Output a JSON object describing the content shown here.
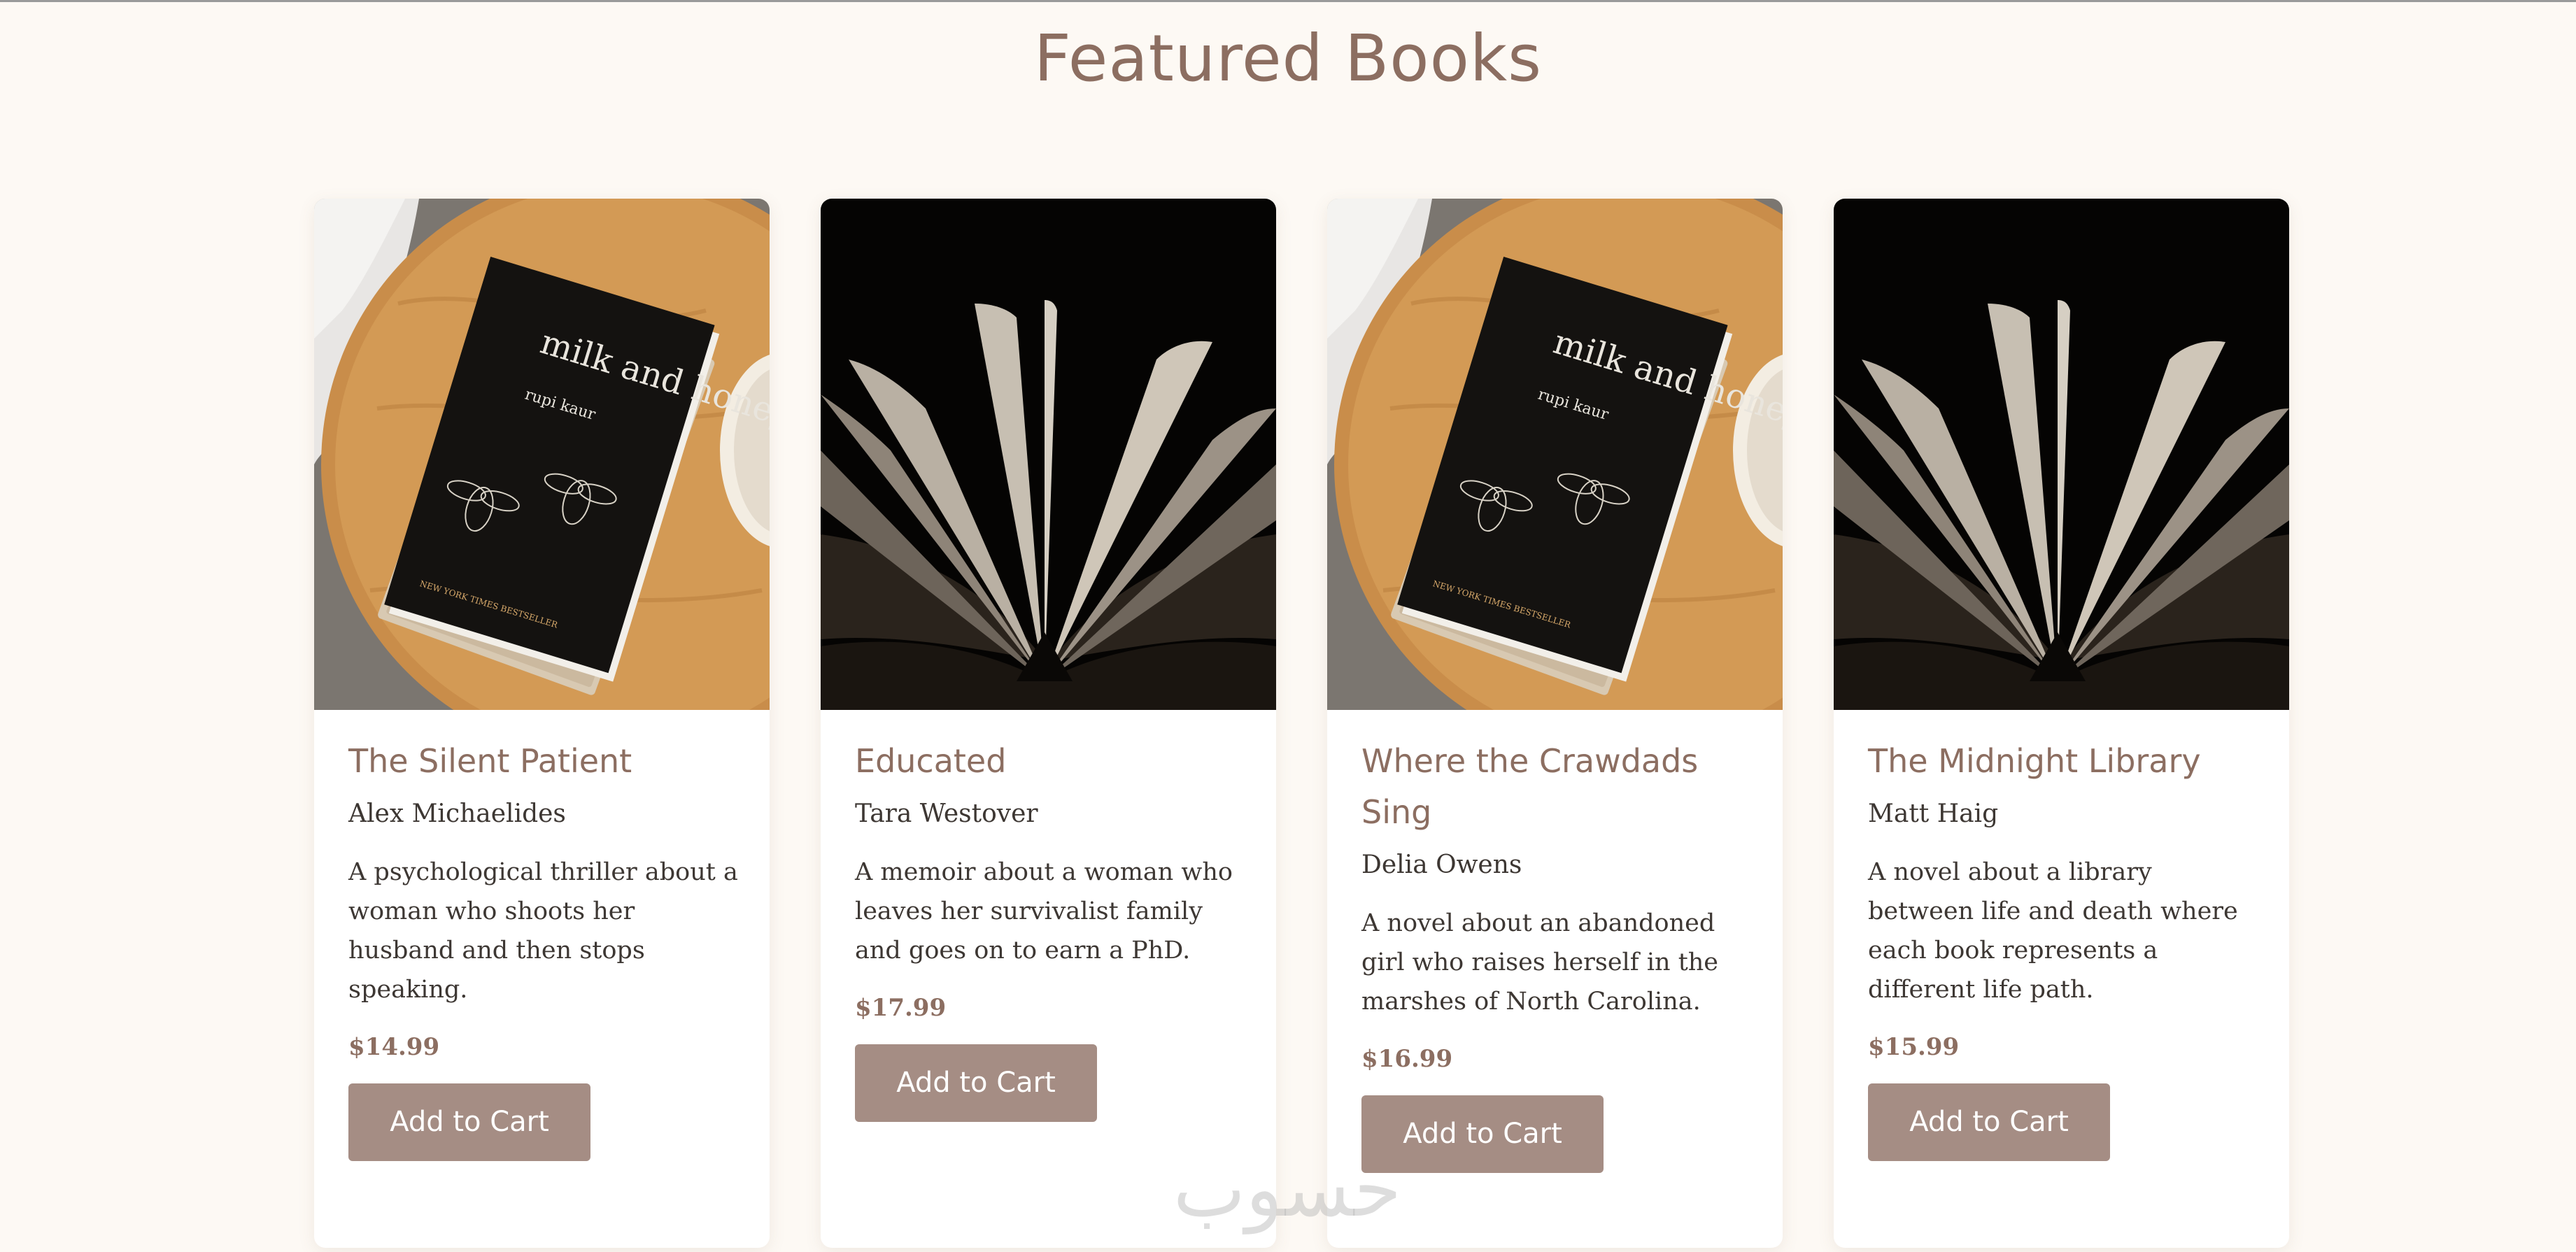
{
  "page": {
    "section_title": "Featured Books",
    "watermark_text": "حسوب"
  },
  "colors": {
    "background": "#fdf9f4",
    "accent": "#8c6e61",
    "button": "#a58d84",
    "text": "#3d3733"
  },
  "books": [
    {
      "title": "The Silent Patient",
      "author": "Alex Michaelides",
      "description": "A psychological thriller about a woman who shoots her husband and then stops speaking.",
      "price": "$14.99",
      "button_label": "Add to Cart",
      "cover_image": "milk-and-honey-photo",
      "cover_title": "milk and honey",
      "cover_author": "rupi kaur",
      "cover_badge": "NEW YORK TIMES BESTSELLER"
    },
    {
      "title": "Educated",
      "author": "Tara Westover",
      "description": "A memoir about a woman who leaves her survivalist family and goes on to earn a PhD.",
      "price": "$17.99",
      "button_label": "Add to Cart",
      "cover_image": "open-book-photo"
    },
    {
      "title": "Where the Crawdads Sing",
      "author": "Delia Owens",
      "description": "A novel about an abandoned girl who raises herself in the marshes of North Carolina.",
      "price": "$16.99",
      "button_label": "Add to Cart",
      "cover_image": "milk-and-honey-photo",
      "cover_title": "milk and honey",
      "cover_author": "rupi kaur",
      "cover_badge": "NEW YORK TIMES BESTSELLER"
    },
    {
      "title": "The Midnight Library",
      "author": "Matt Haig",
      "description": "A novel about a library between life and death where each book represents a different life path.",
      "price": "$15.99",
      "button_label": "Add to Cart",
      "cover_image": "open-book-photo"
    }
  ]
}
